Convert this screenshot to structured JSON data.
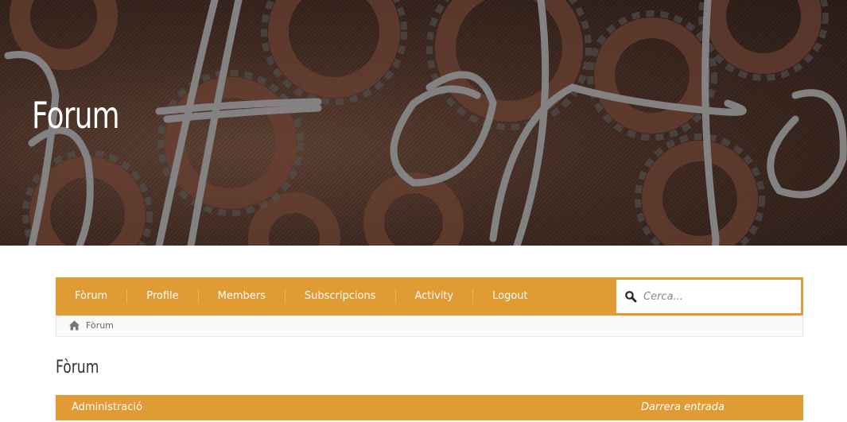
{
  "hero": {
    "title": "Forum"
  },
  "nav": {
    "items": [
      {
        "label": "Fòrum"
      },
      {
        "label": "Profile"
      },
      {
        "label": "Members"
      },
      {
        "label": "Subscripcions"
      },
      {
        "label": "Activity"
      },
      {
        "label": "Logout"
      }
    ],
    "search_placeholder": "Cerca..."
  },
  "breadcrumb": {
    "items": [
      "Fòrum"
    ]
  },
  "page": {
    "heading": "Fòrum"
  },
  "forum_table": {
    "col_left": "Administració",
    "col_right": "Darrera entrada"
  },
  "colors": {
    "accent": "#e09b34",
    "hero_bg": "#4a3127"
  },
  "icons": {
    "search": "search-icon",
    "home": "home-icon"
  }
}
